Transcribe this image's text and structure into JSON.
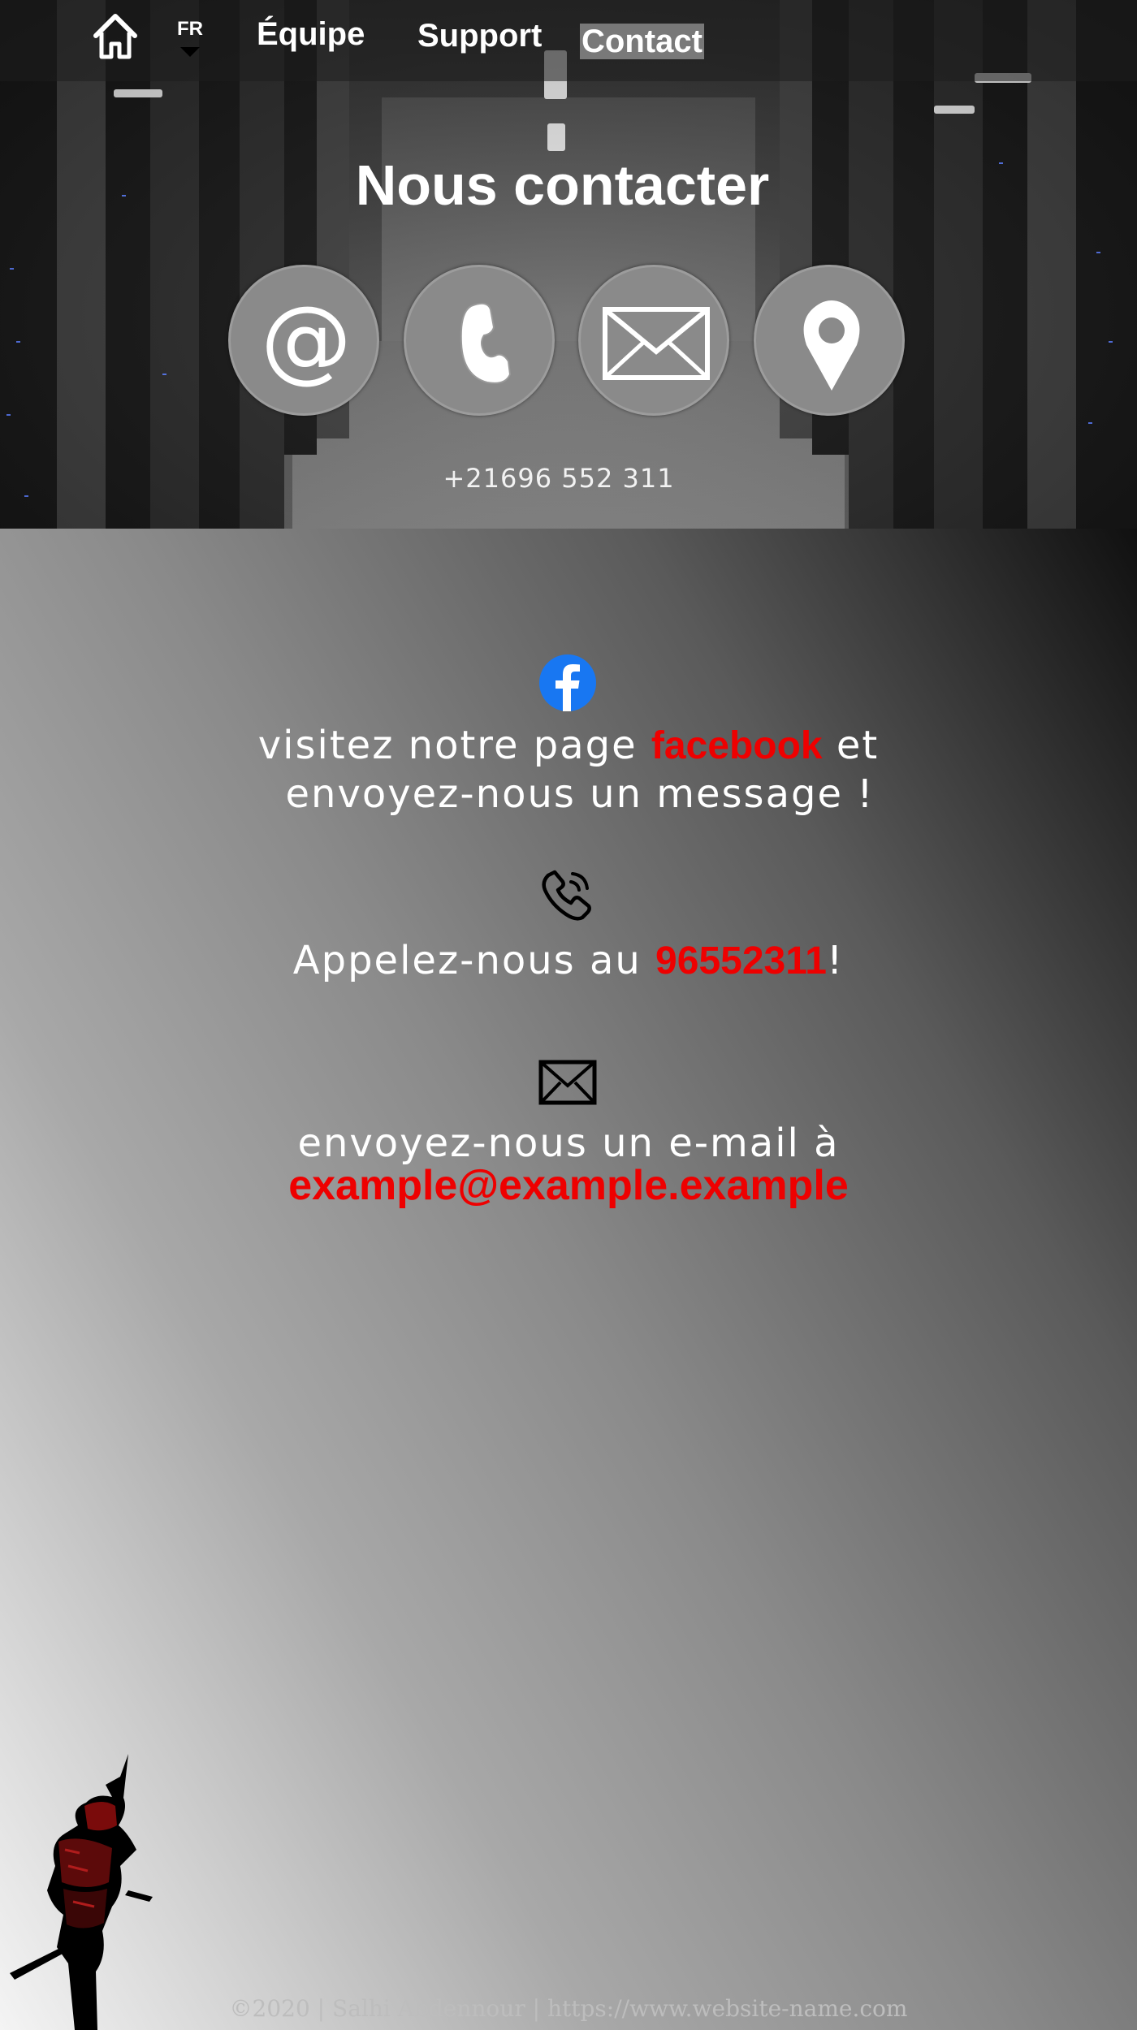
{
  "nav": {
    "home_icon": "home-icon",
    "language": "FR",
    "links": [
      "Équipe",
      "Support",
      "Contact"
    ],
    "active": "Contact"
  },
  "hero": {
    "title": "Nous contacter",
    "buttons": [
      "at-sign-icon",
      "phone-icon",
      "envelope-icon",
      "location-pin-icon"
    ],
    "phone": "+21696 552 311"
  },
  "contact": {
    "facebook": {
      "icon": "facebook-icon",
      "prefix": "visitez notre page ",
      "link": "facebook",
      "suffix": " et",
      "line2": "envoyez-nous un message !"
    },
    "call": {
      "icon": "phone-icon",
      "prefix": "Appelez-nous au ",
      "number": "96552311",
      "suffix": "!"
    },
    "mail": {
      "icon": "envelope-icon",
      "prefix": "envoyez-nous un e-mail à",
      "address": "example@example.example"
    }
  },
  "footer": {
    "text": "©2020 | Salhi Abdennour | https://www.website-name.com"
  },
  "colors": {
    "accent": "#ee0000",
    "facebook": "#1877f2"
  }
}
